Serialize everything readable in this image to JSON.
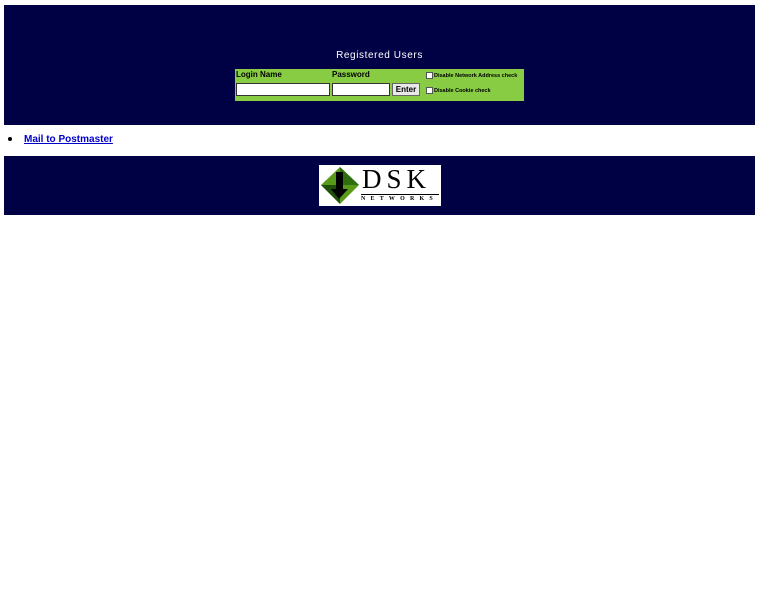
{
  "header": {
    "title": "Registered Users"
  },
  "login": {
    "login_label": "Login Name",
    "password_label": "Password",
    "login_value": "",
    "password_value": "",
    "enter_label": "Enter",
    "network_check_label": "Disable Network Address check",
    "cookie_check_label": "Disable Cookie check"
  },
  "links": {
    "mail_label": "Mail to Postmaster"
  },
  "footer": {
    "logo_text": "DSK",
    "logo_sub": "NETWORKS"
  },
  "colors": {
    "band": "#000044",
    "login_panel": "#88cc44",
    "link": "#0000cc"
  }
}
